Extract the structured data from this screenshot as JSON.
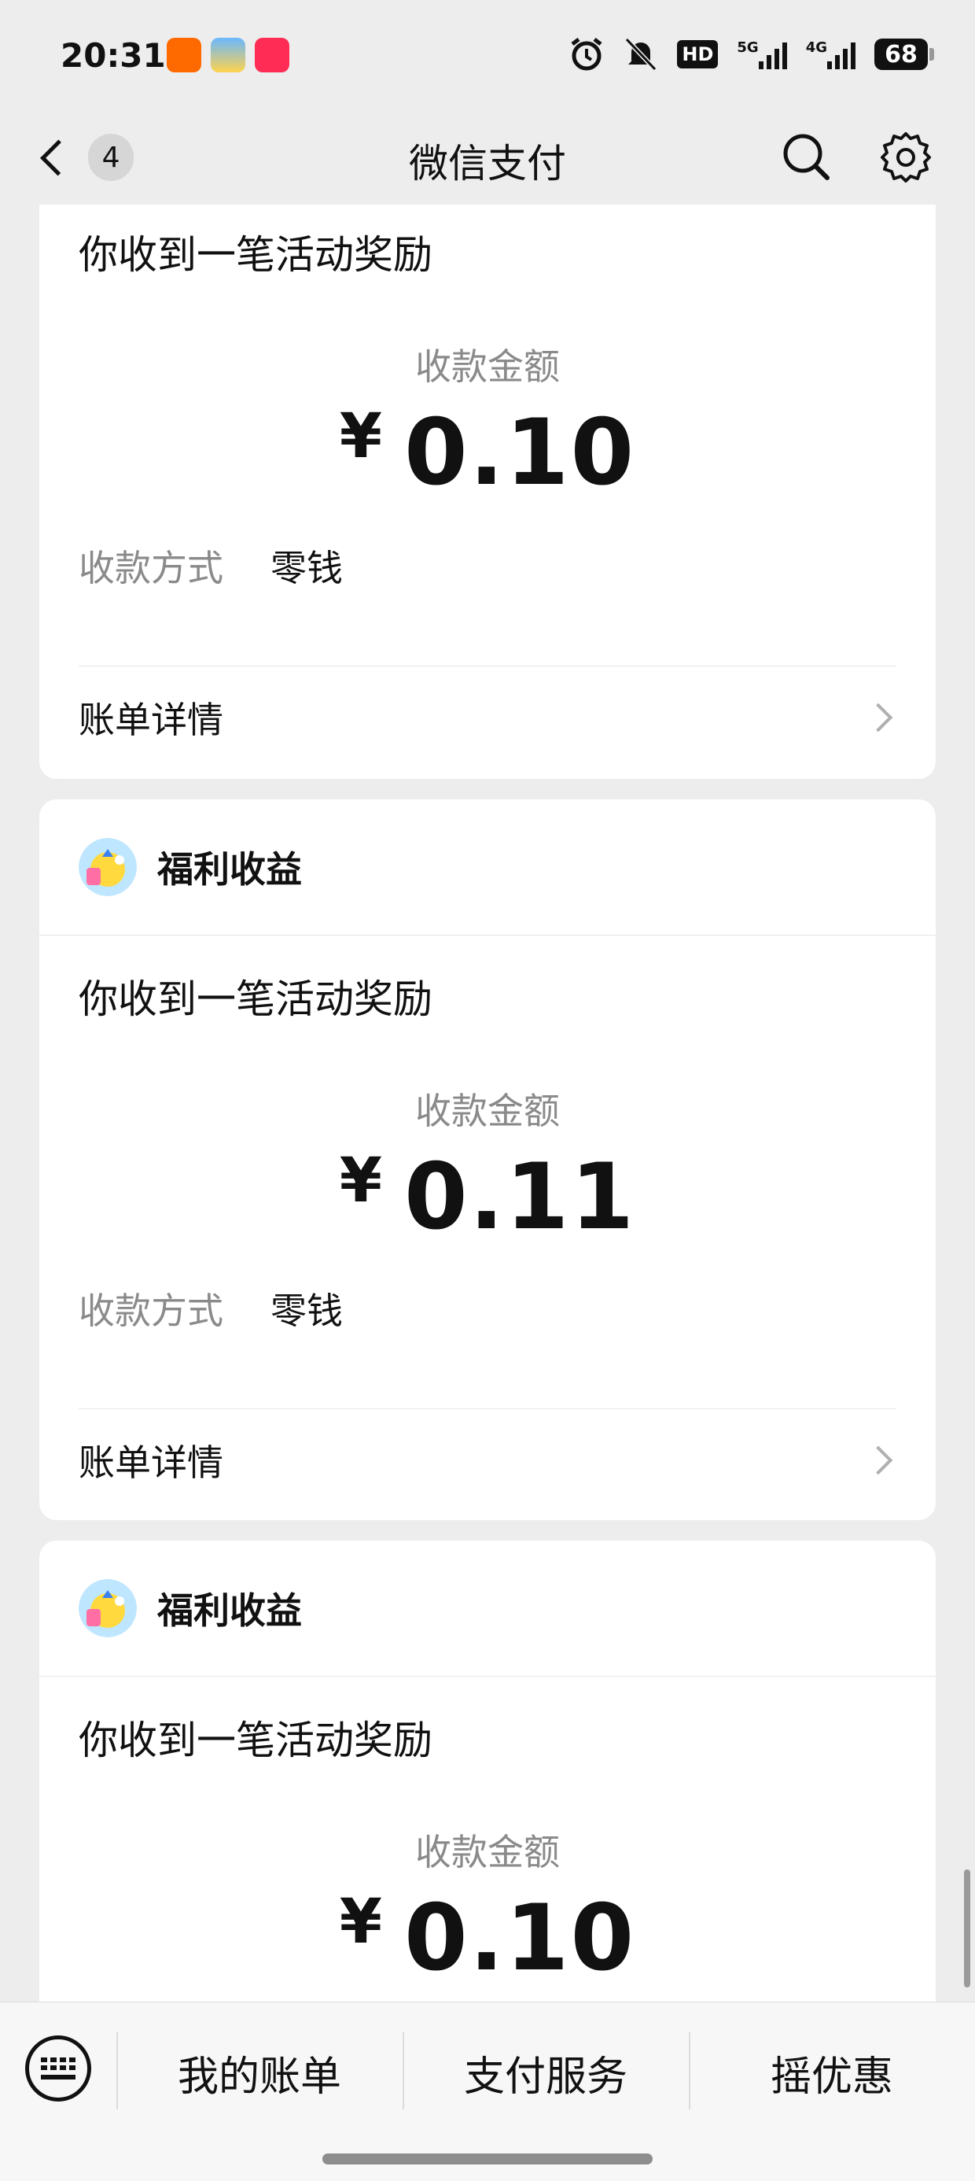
{
  "status_bar": {
    "time": "20:31",
    "hd_label": "HD",
    "network_5g": "5G",
    "network_4g": "4G",
    "battery": "68",
    "app_icons": [
      "taobao-app-icon",
      "game-app-icon",
      "618-app-icon"
    ]
  },
  "nav": {
    "back_count": "4",
    "title": "微信支付"
  },
  "cards": [
    {
      "title": "你收到一笔活动奖励",
      "amount_label": "收款金额",
      "currency": "¥",
      "amount": "0.10",
      "method_key": "收款方式",
      "method_value": "零钱",
      "detail_label": "账单详情"
    },
    {
      "header_name": "福利收益",
      "title": "你收到一笔活动奖励",
      "amount_label": "收款金额",
      "currency": "¥",
      "amount": "0.11",
      "method_key": "收款方式",
      "method_value": "零钱",
      "detail_label": "账单详情"
    },
    {
      "header_name": "福利收益",
      "title": "你收到一笔活动奖励",
      "amount_label": "收款金额",
      "currency": "¥",
      "amount": "0.10"
    }
  ],
  "bottom_menu": {
    "items": [
      "我的账单",
      "支付服务",
      "摇优惠"
    ]
  },
  "colors": {
    "background": "#ededed",
    "card": "#ffffff",
    "secondary_text": "#8a8a8a"
  }
}
